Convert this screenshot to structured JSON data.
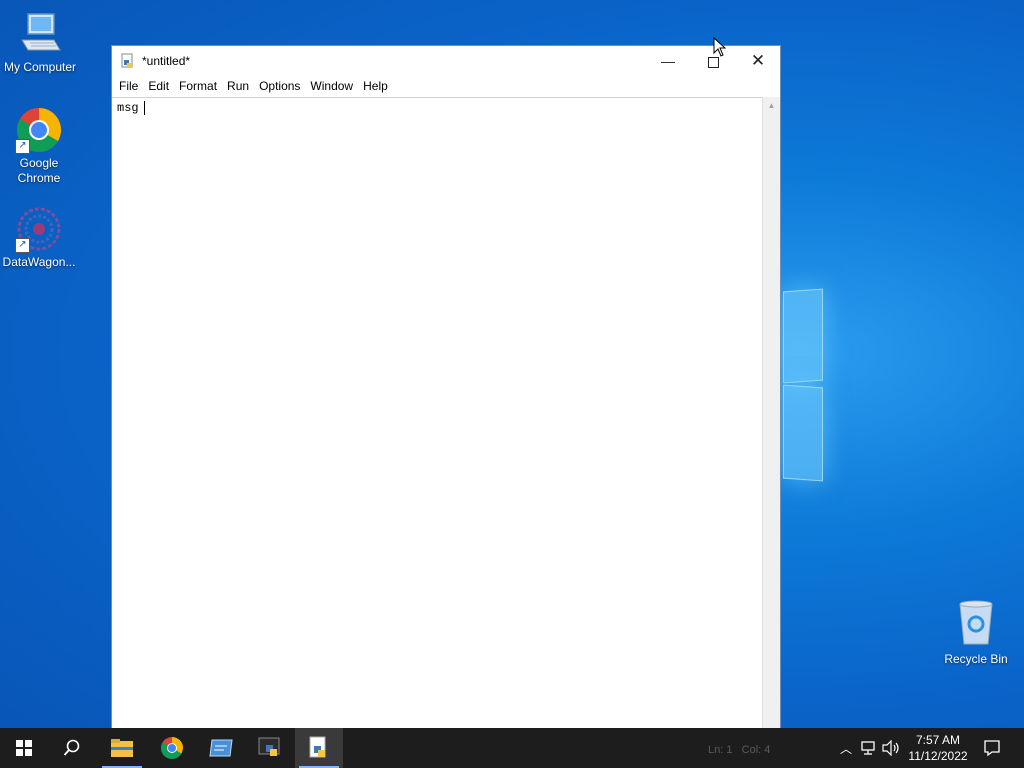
{
  "desktop": {
    "icons": [
      {
        "label": "My Computer"
      },
      {
        "label": "Google Chrome"
      },
      {
        "label": "DataWagon..."
      }
    ],
    "recycle_bin_label": "Recycle Bin"
  },
  "window": {
    "title": "*untitled*",
    "menu": [
      "File",
      "Edit",
      "Format",
      "Run",
      "Options",
      "Window",
      "Help"
    ],
    "editor_text": "msg",
    "status": {
      "line": "Ln: 1",
      "col": "Col: 4"
    }
  },
  "taskbar": {
    "time": "7:57 AM",
    "date": "11/12/2022"
  },
  "colors": {
    "taskbar": "#1d1d1d",
    "desktop": "#0a63c8"
  }
}
